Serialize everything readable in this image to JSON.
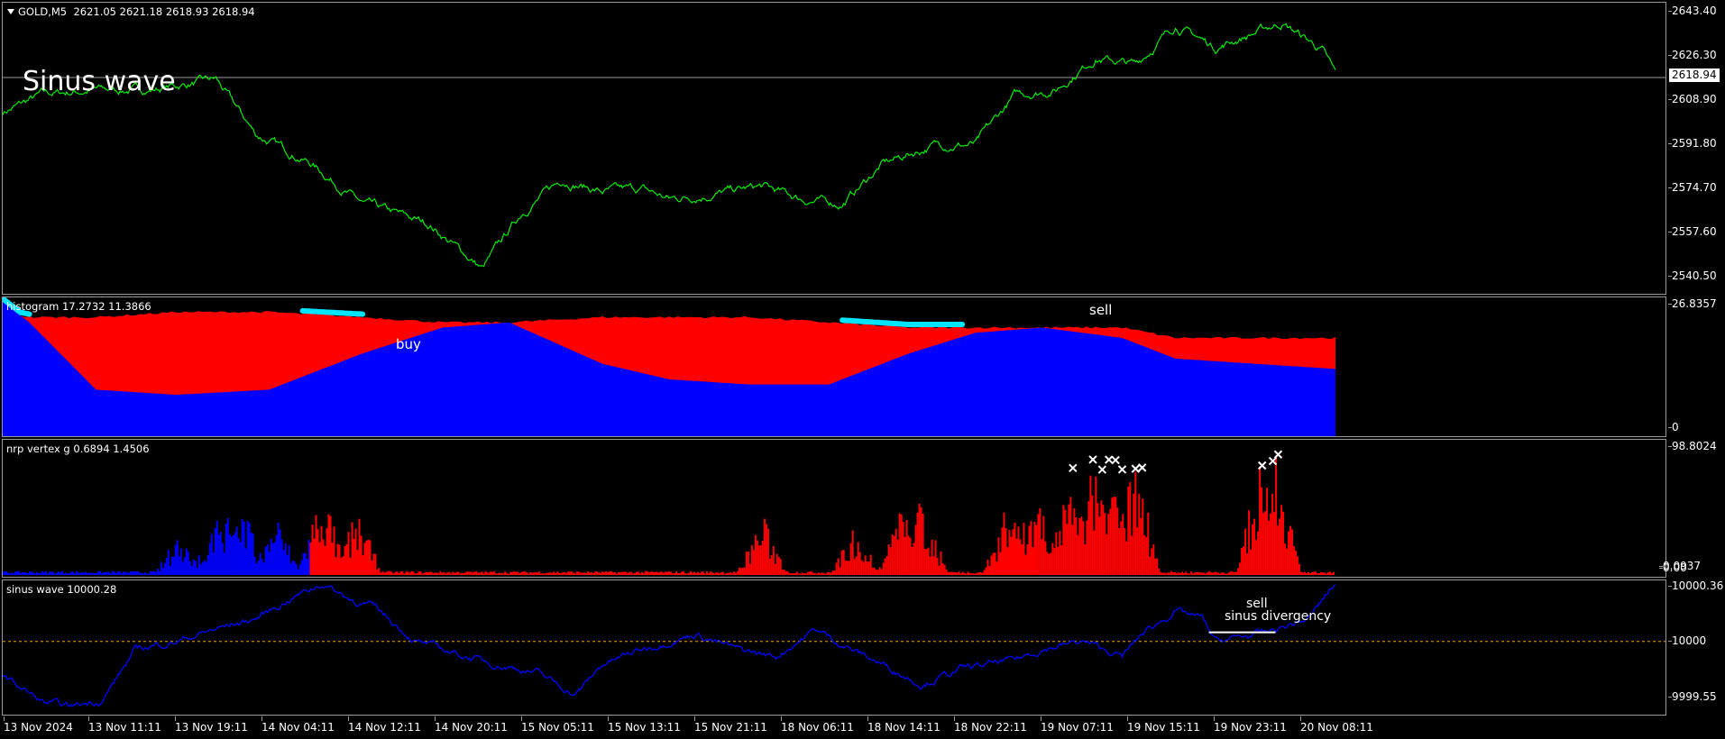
{
  "window": {
    "symbol": "GOLD,M5",
    "ohlc": "2621.05 2621.18 2618.93 2618.94",
    "chart_title": "Sinus wave",
    "current_price": "2618.94"
  },
  "panes": {
    "histogram": {
      "label": "histogram 17.2732 11.3866",
      "buy_label": "buy",
      "sell_label": "sell"
    },
    "nrp": {
      "label": "nrp vertex g 0.6894 1.4506"
    },
    "sinus": {
      "label": "sinus wave 10000.28",
      "sell_label": "sell",
      "divergence_label": "sinus divergency"
    }
  },
  "colors": {
    "price_line": "#00ff00",
    "hist_bull": "#0000ff",
    "hist_bear": "#ff0000",
    "hist_signal": "#00e5ff",
    "nrp_low": "#0000ff",
    "nrp_high": "#ff0000",
    "sinus_line": "#0000ff",
    "level_line": "#ffa500",
    "border": "#9a9a9a"
  },
  "axes": {
    "price_ticks": [
      "2643.40",
      "2626.30",
      "2608.90",
      "2591.80",
      "2574.70",
      "2557.60",
      "2540.50"
    ],
    "hist_ticks": [
      "26.8357",
      "0"
    ],
    "nrp_ticks": [
      "98.8024",
      "0.0937",
      "0.00"
    ],
    "sinus_ticks": [
      "10000.36",
      "10000",
      "9999.55"
    ],
    "time_ticks": [
      "13 Nov 2024",
      "13 Nov 11:11",
      "13 Nov 19:11",
      "14 Nov 04:11",
      "14 Nov 12:11",
      "14 Nov 20:11",
      "15 Nov 05:11",
      "15 Nov 13:11",
      "15 Nov 21:11",
      "18 Nov 06:11",
      "18 Nov 14:11",
      "18 Nov 22:11",
      "19 Nov 07:11",
      "19 Nov 15:11",
      "19 Nov 23:11",
      "20 Nov 08:11"
    ]
  },
  "chart_data": [
    {
      "type": "line",
      "name": "price",
      "ylim": [
        2532,
        2649
      ],
      "x": [
        0,
        0.03,
        0.07,
        0.11,
        0.16,
        0.19,
        0.23,
        0.27,
        0.32,
        0.36,
        0.39,
        0.42,
        0.45,
        0.48,
        0.5,
        0.53,
        0.57,
        0.6,
        0.63,
        0.66,
        0.7,
        0.73,
        0.76,
        0.79,
        0.82,
        0.85,
        0.88,
        0.91,
        0.94,
        0.96,
        0.99,
        1.0
      ],
      "y": [
        2605,
        2612,
        2614,
        2614,
        2618,
        2596,
        2585,
        2568,
        2560,
        2542,
        2565,
        2578,
        2573,
        2574,
        2570,
        2572,
        2575,
        2570,
        2568,
        2584,
        2592,
        2592,
        2612,
        2614,
        2627,
        2624,
        2640,
        2631,
        2637,
        2641,
        2630,
        2620
      ]
    },
    {
      "type": "area",
      "name": "histogram",
      "ylim": [
        0,
        26.8357
      ],
      "x": [
        0,
        0.02,
        0.07,
        0.13,
        0.2,
        0.27,
        0.33,
        0.38,
        0.45,
        0.5,
        0.56,
        0.62,
        0.68,
        0.73,
        0.78,
        0.84,
        0.88,
        1.0
      ],
      "bull": [
        26,
        22,
        9,
        8,
        9,
        16,
        21,
        22,
        14,
        11,
        10,
        10,
        16,
        20,
        21,
        19,
        15,
        13
      ],
      "bear": [
        24,
        23,
        23,
        24,
        24,
        23,
        22,
        22,
        23,
        23,
        23,
        22,
        21,
        21,
        21,
        21,
        19,
        19
      ]
    },
    {
      "type": "bar",
      "name": "nrp vertex",
      "ylim": [
        0,
        98.8024
      ],
      "spikes": [
        {
          "x": 0.133,
          "v": 35
        },
        {
          "x": 0.16,
          "v": 45
        },
        {
          "x": 0.17,
          "v": 50
        },
        {
          "x": 0.18,
          "v": 55
        },
        {
          "x": 0.205,
          "v": 48
        },
        {
          "x": 0.24,
          "v": 70
        },
        {
          "x": 0.266,
          "v": 52
        },
        {
          "x": 0.57,
          "v": 48
        },
        {
          "x": 0.64,
          "v": 40
        },
        {
          "x": 0.675,
          "v": 55
        },
        {
          "x": 0.69,
          "v": 62
        },
        {
          "x": 0.755,
          "v": 60
        },
        {
          "x": 0.775,
          "v": 72
        },
        {
          "x": 0.8,
          "v": 75
        },
        {
          "x": 0.818,
          "v": 88
        },
        {
          "x": 0.832,
          "v": 92
        },
        {
          "x": 0.85,
          "v": 96
        },
        {
          "x": 0.945,
          "v": 99
        },
        {
          "x": 0.955,
          "v": 99
        }
      ],
      "markers_x": [
        0.803,
        0.818,
        0.825,
        0.83,
        0.835,
        0.84,
        0.85,
        0.855,
        0.945,
        0.953,
        0.957
      ]
    },
    {
      "type": "line",
      "name": "sinus wave",
      "ylim": [
        9999.52,
        10000.4
      ],
      "level": 10000,
      "x": [
        0,
        0.03,
        0.05,
        0.075,
        0.1,
        0.13,
        0.16,
        0.19,
        0.22,
        0.24,
        0.26,
        0.28,
        0.31,
        0.34,
        0.37,
        0.4,
        0.43,
        0.45,
        0.48,
        0.52,
        0.55,
        0.58,
        0.61,
        0.63,
        0.66,
        0.69,
        0.72,
        0.76,
        0.78,
        0.81,
        0.84,
        0.855,
        0.88,
        0.9,
        0.91,
        0.95,
        0.98,
        1.0
      ],
      "y": [
        9999.78,
        9999.6,
        9999.57,
        9999.62,
        9999.95,
        10000.0,
        10000.08,
        10000.15,
        10000.3,
        10000.38,
        10000.28,
        10000.22,
        10000.0,
        9999.92,
        9999.85,
        9999.8,
        9999.65,
        9999.85,
        9999.95,
        10000.05,
        9999.95,
        9999.9,
        10000.08,
        9999.98,
        9999.85,
        9999.72,
        9999.82,
        9999.88,
        9999.95,
        10000.0,
        9999.9,
        10000.05,
        10000.2,
        10000.15,
        10000.0,
        10000.06,
        10000.15,
        10000.38
      ]
    }
  ]
}
